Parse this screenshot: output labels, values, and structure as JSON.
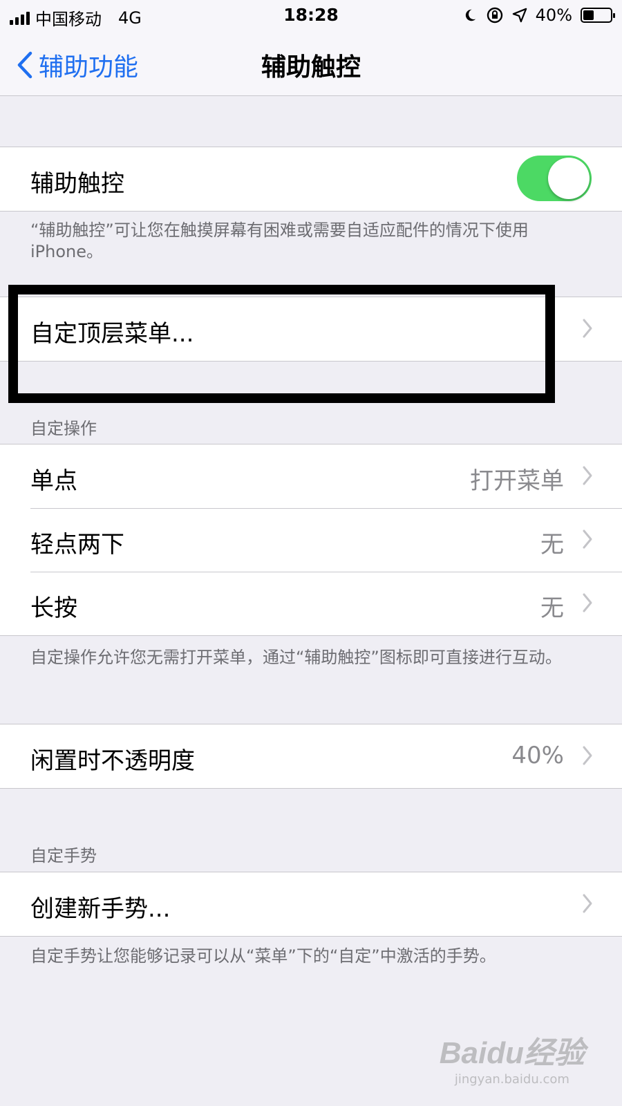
{
  "status_bar": {
    "carrier": "中国移动",
    "network": "4G",
    "time": "18:28",
    "battery": "40%",
    "battery_level": 0.4,
    "icons": [
      "moon-icon",
      "rotation-lock-icon",
      "location-icon"
    ]
  },
  "nav": {
    "back_label": "辅助功能",
    "title": "辅助触控"
  },
  "assistive_touch": {
    "label": "辅助触控",
    "enabled": true,
    "toggle_color": "#4cd964",
    "footer": "“辅助触控”可让您在触摸屏幕有困难或需要自适应配件的情况下使用 iPhone。"
  },
  "top_level_menu": {
    "label": "自定顶层菜单..."
  },
  "custom_actions": {
    "header": "自定操作",
    "items": [
      {
        "label": "单点",
        "value": "打开菜单"
      },
      {
        "label": "轻点两下",
        "value": "无"
      },
      {
        "label": "长按",
        "value": "无"
      }
    ],
    "footer": "自定操作允许您无需打开菜单，通过“辅助触控”图标即可直接进行互动。"
  },
  "idle_opacity": {
    "label": "闲置时不透明度",
    "value": "40%"
  },
  "custom_gestures": {
    "header": "自定手势",
    "create_label": "创建新手势...",
    "footer": "自定手势让您能够记录可以从“菜单”下的“自定”中激活的手势。"
  },
  "watermark": {
    "logo": "Baidu经验",
    "site": "jingyan.baidu.com"
  },
  "colors": {
    "accent": "#1f6ff0",
    "background": "#efeef4",
    "secondary_text": "#8a8a8e"
  }
}
